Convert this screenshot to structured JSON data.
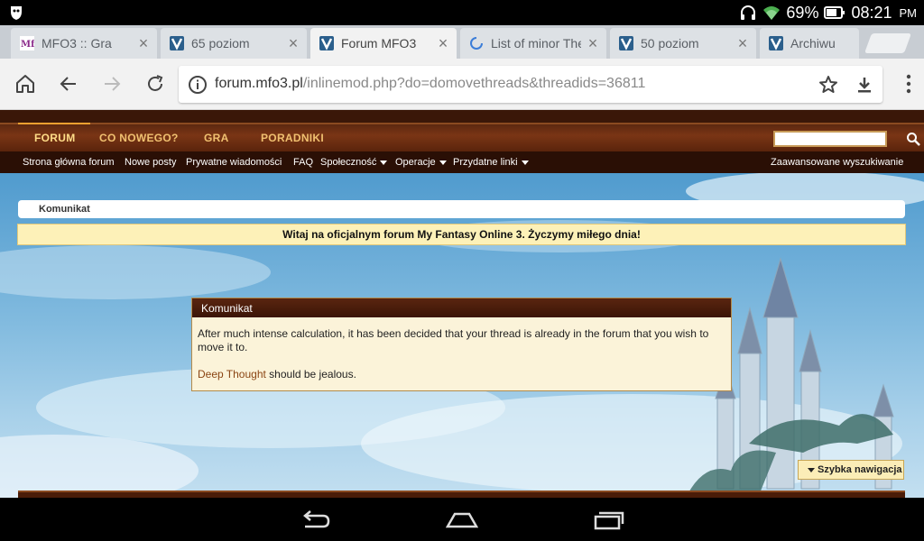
{
  "status_bar": {
    "battery_percent": "69%",
    "time": "08:21",
    "ampm": "PM"
  },
  "tabs": [
    {
      "title": "MFO3 :: Gra",
      "favicon": "mfo3-favicon",
      "active": false
    },
    {
      "title": "65 poziom",
      "favicon": "vbulletin-favicon",
      "active": false
    },
    {
      "title": "Forum MFO3",
      "favicon": "vbulletin-favicon",
      "active": true
    },
    {
      "title": "List of minor The",
      "favicon": "loading-spinner",
      "active": false
    },
    {
      "title": "50 poziom",
      "favicon": "vbulletin-favicon",
      "active": false
    },
    {
      "title": "Archiwu",
      "favicon": "vbulletin-favicon",
      "active": false
    }
  ],
  "omnibox": {
    "host": "forum.mfo3.pl",
    "path": "/inlinemod.php?do=domovethreads&threadids=36811"
  },
  "forum": {
    "nav_tabs": [
      "FORUM",
      "CO NOWEGO?",
      "GRA",
      "PORADNIKI"
    ],
    "sublinks": {
      "home": "Strona główna forum",
      "new_posts": "Nowe posty",
      "pm": "Prywatne wiadomości",
      "faq": "FAQ",
      "community": "Społeczność",
      "operations": "Operacje",
      "useful_links": "Przydatne linki",
      "advanced_search": "Zaawansowane wyszukiwanie"
    },
    "breadcrumb": "Komunikat",
    "welcome": "Witaj na oficjalnym forum My Fantasy Online 3. Życzymy miłego dnia!",
    "message": {
      "title": "Komunikat",
      "line1": "After much intense calculation, it has been decided that your thread is already in the forum that you wish to move it to.",
      "link": "Deep Thought",
      "line2_rest": " should be jealous."
    },
    "quick_nav": "Szybka nawigacja"
  },
  "colors": {
    "nav_tab_text": "#f0c070",
    "welcome_bg": "#fdf1b8",
    "message_bg": "#fbf3d9",
    "header_brown": "#3a1708"
  }
}
